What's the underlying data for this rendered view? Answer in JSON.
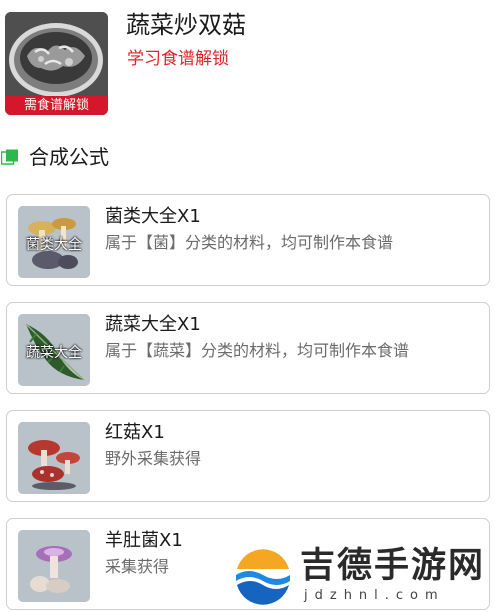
{
  "header": {
    "title": "蔬菜炒双菇",
    "subtitle": "学习食谱解锁",
    "lock_badge": "需食谱解锁",
    "dish_image": "stir-fried-mushroom-dish-image"
  },
  "section": {
    "icon": "section-square-icon",
    "title": "合成公式"
  },
  "ingredients": [
    {
      "name": "菌类大全X1",
      "desc": "属于【菌】分类的材料，均可制作本食谱",
      "overlay": "菌类大全",
      "image": "mushroom-category-image"
    },
    {
      "name": "蔬菜大全X1",
      "desc": "属于【蔬菜】分类的材料，均可制作本食谱",
      "overlay": "蔬菜大全",
      "image": "vegetable-category-image"
    },
    {
      "name": "红菇X1",
      "desc": "野外采集获得",
      "overlay": "",
      "image": "red-mushroom-image"
    },
    {
      "name": "羊肚菌X1",
      "desc": "采集获得",
      "overlay": "",
      "image": "morel-mushroom-image"
    }
  ],
  "watermark": {
    "text": "吉德手游网",
    "domain": "jdzhnl.com",
    "logo": "wave-logo-icon"
  },
  "colors": {
    "accent_red": "#e0242b",
    "badge_red": "#d4172a",
    "section_green": "#2eb84a",
    "card_border": "#cfcfcf",
    "desc_gray": "#6b6b6b"
  }
}
